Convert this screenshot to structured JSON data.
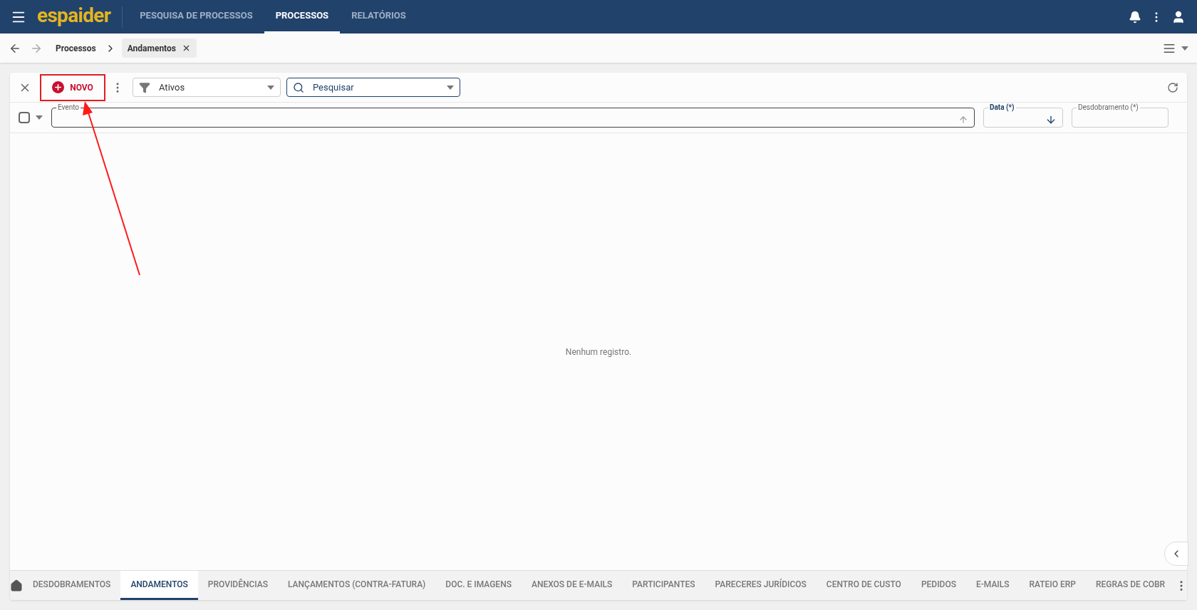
{
  "app_bar": {
    "logo": "espaider",
    "nav": [
      {
        "label": "PESQUISA DE PROCESSOS",
        "selected": false
      },
      {
        "label": "PROCESSOS",
        "selected": true
      },
      {
        "label": "RELATÓRIOS",
        "selected": false
      }
    ]
  },
  "breadcrumb": {
    "items": [
      {
        "label": "Processos",
        "kind": "link"
      },
      {
        "label": "Andamentos",
        "kind": "chip"
      }
    ]
  },
  "toolbar": {
    "new_button": "NOVO",
    "filter": {
      "value": "Ativos"
    },
    "search": {
      "placeholder": "Pesquisar"
    }
  },
  "columns": [
    {
      "label": "Evento",
      "kind": "sort-up"
    },
    {
      "label": "Data (*)",
      "kind": "sort-down"
    },
    {
      "label": "Desdobramento (*)",
      "kind": "plain"
    }
  ],
  "select_all": {
    "checked": false
  },
  "empty_message": "Nenhum registro.",
  "tabs": [
    {
      "label": "DESDOBRAMENTOS",
      "selected": false
    },
    {
      "label": "ANDAMENTOS",
      "selected": true
    },
    {
      "label": "PROVIDÊNCIAS",
      "selected": false
    },
    {
      "label": "LANÇAMENTOS (CONTRA-FATURA)",
      "selected": false
    },
    {
      "label": "DOC. E IMAGENS",
      "selected": false
    },
    {
      "label": "ANEXOS DE E-MAILS",
      "selected": false
    },
    {
      "label": "PARTICIPANTES",
      "selected": false
    },
    {
      "label": "PARECERES JURÍDICOS",
      "selected": false
    },
    {
      "label": "CENTRO DE CUSTO",
      "selected": false
    },
    {
      "label": "PEDIDOS",
      "selected": false
    },
    {
      "label": "E-MAILS",
      "selected": false
    },
    {
      "label": "RATEIO ERP",
      "selected": false
    },
    {
      "label": "REGRAS DE COBR",
      "selected": false
    }
  ]
}
